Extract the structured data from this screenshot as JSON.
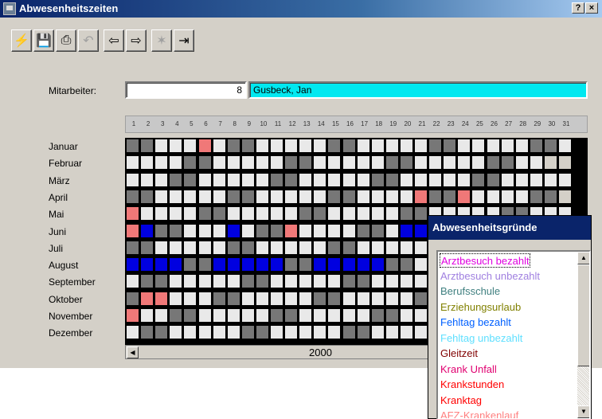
{
  "window": {
    "title": "Abwesenheitszeiten",
    "help_btn": "?",
    "close_btn": "×"
  },
  "toolbar": {
    "buttons": [
      {
        "icon": "lightning-icon",
        "glyph": "⚡",
        "enabled": true
      },
      {
        "icon": "save-icon",
        "glyph": "💾",
        "enabled": true
      },
      {
        "icon": "print-icon",
        "glyph": "⎙",
        "enabled": true
      },
      {
        "icon": "undo-icon",
        "glyph": "↶",
        "enabled": false
      },
      {
        "icon": "arrow-left-icon",
        "glyph": "⇦",
        "enabled": true
      },
      {
        "icon": "arrow-right-icon",
        "glyph": "⇨",
        "enabled": true
      },
      {
        "icon": "wizard-icon",
        "glyph": "✶",
        "enabled": false
      },
      {
        "icon": "exit-door-icon",
        "glyph": "⇥",
        "enabled": true
      }
    ]
  },
  "employee": {
    "label": "Mitarbeiter:",
    "number": "8",
    "name": "Gusbeck, Jan"
  },
  "days": [
    "1",
    "2",
    "3",
    "4",
    "5",
    "6",
    "7",
    "8",
    "9",
    "10",
    "11",
    "12",
    "13",
    "14",
    "15",
    "16",
    "17",
    "18",
    "19",
    "20",
    "21",
    "22",
    "23",
    "24",
    "25",
    "26",
    "27",
    "28",
    "29",
    "30",
    "31"
  ],
  "months": [
    "Januar",
    "Februar",
    "März",
    "April",
    "Mai",
    "Juni",
    "Juli",
    "August",
    "September",
    "Oktober",
    "November",
    "Dezember"
  ],
  "colors": {
    "weekend": "#777777",
    "workday": "#e9e9e9",
    "absence_red": "#f07878",
    "absence_blue": "#0000e0",
    "selection": "#0a246a"
  },
  "calendar": {
    "year": "2000",
    "start_weekday_index": [
      5,
      1,
      2,
      5,
      0,
      3,
      5,
      1,
      4,
      6,
      2,
      4
    ],
    "month_lengths": [
      31,
      29,
      31,
      30,
      31,
      30,
      31,
      31,
      30,
      31,
      30,
      31
    ],
    "absences": [
      {
        "month": 0,
        "days": [
          6
        ],
        "type": "red"
      },
      {
        "month": 3,
        "days": [
          21,
          24
        ],
        "type": "red"
      },
      {
        "month": 4,
        "days": [
          1
        ],
        "type": "red"
      },
      {
        "month": 5,
        "days": [
          1,
          12
        ],
        "type": "red"
      },
      {
        "month": 5,
        "days": [
          2,
          8,
          20,
          21
        ],
        "type": "blue"
      },
      {
        "month": 7,
        "days": [
          1,
          2,
          3,
          4,
          7,
          8,
          9,
          10,
          11,
          14,
          15,
          16,
          17,
          18
        ],
        "type": "blue"
      },
      {
        "month": 9,
        "days": [
          2,
          3
        ],
        "type": "red"
      },
      {
        "month": 10,
        "days": [
          1
        ],
        "type": "red"
      }
    ]
  },
  "year_scroller": {
    "value": "2000",
    "left_arrow": "◀"
  },
  "reasons_popup": {
    "title": "Abwesenheitsgründe",
    "items": [
      {
        "label": "Arztbesuch bezahlt",
        "color": "#e000e0",
        "selected": true
      },
      {
        "label": "Arztbesuch unbezahlt",
        "color": "#a080e0"
      },
      {
        "label": "Berufsschule",
        "color": "#408080"
      },
      {
        "label": "Erziehungsurlaub",
        "color": "#808000"
      },
      {
        "label": "Fehltag bezahlt",
        "color": "#0060ff"
      },
      {
        "label": "Fehltag unbezahlt",
        "color": "#60e0ff"
      },
      {
        "label": "Gleitzeit",
        "color": "#800000"
      },
      {
        "label": "Krank Unfall",
        "color": "#e00070"
      },
      {
        "label": "Krankstunden",
        "color": "#ff0000"
      },
      {
        "label": "Kranktag",
        "color": "#ff0000"
      },
      {
        "label": "AFZ-Krankenlauf",
        "color": "#ff8080"
      }
    ],
    "scroll_up": "▲",
    "scroll_down": "▼"
  }
}
